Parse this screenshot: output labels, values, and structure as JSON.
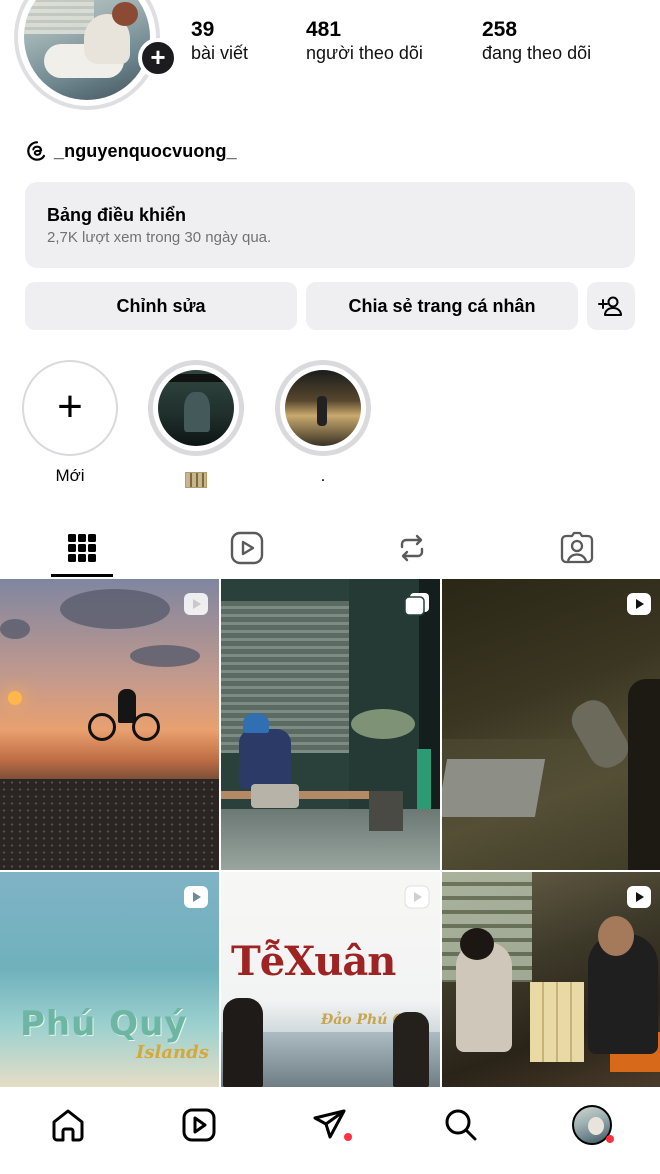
{
  "profile": {
    "stats": [
      {
        "count": "39",
        "label": "bài viết"
      },
      {
        "count": "481",
        "label": "người theo dõi"
      },
      {
        "count": "258",
        "label": "đang theo dõi"
      }
    ],
    "threads_handle": "_nguyenquocvuong_"
  },
  "dashboard": {
    "title": "Bảng điều khiển",
    "subtitle": "2,7K lượt xem trong 30 ngày qua."
  },
  "actions": {
    "edit_label": "Chỉnh sửa",
    "share_label": "Chia sẻ trang cá nhân"
  },
  "highlights": [
    {
      "label": "Mới"
    },
    {
      "label": ""
    },
    {
      "label": "."
    }
  ],
  "tabs": [
    "grid-icon",
    "reels-icon",
    "reposts-icon",
    "tagged-icon"
  ],
  "posts": [
    {
      "type": "reel",
      "icon": "reel-badge-icon"
    },
    {
      "type": "carousel",
      "icon": "carousel-badge-icon"
    },
    {
      "type": "reel",
      "icon": "reel-badge-icon"
    },
    {
      "type": "reel",
      "icon": "reel-badge-icon",
      "overlay_title": "Phú Quý",
      "overlay_subtitle": "Islands"
    },
    {
      "type": "reel",
      "icon": "reel-badge-icon",
      "overlay_title": "TễXuân",
      "overlay_subtitle": "Đảo Phú Quý"
    },
    {
      "type": "reel",
      "icon": "reel-badge-icon"
    }
  ],
  "bottom_nav": [
    "home-icon",
    "reels-icon",
    "messages-icon",
    "search-icon",
    "profile-avatar"
  ],
  "colors": {
    "notification_dot": "#ff3040",
    "button_bg": "#efeff1",
    "muted_text": "#727272"
  }
}
